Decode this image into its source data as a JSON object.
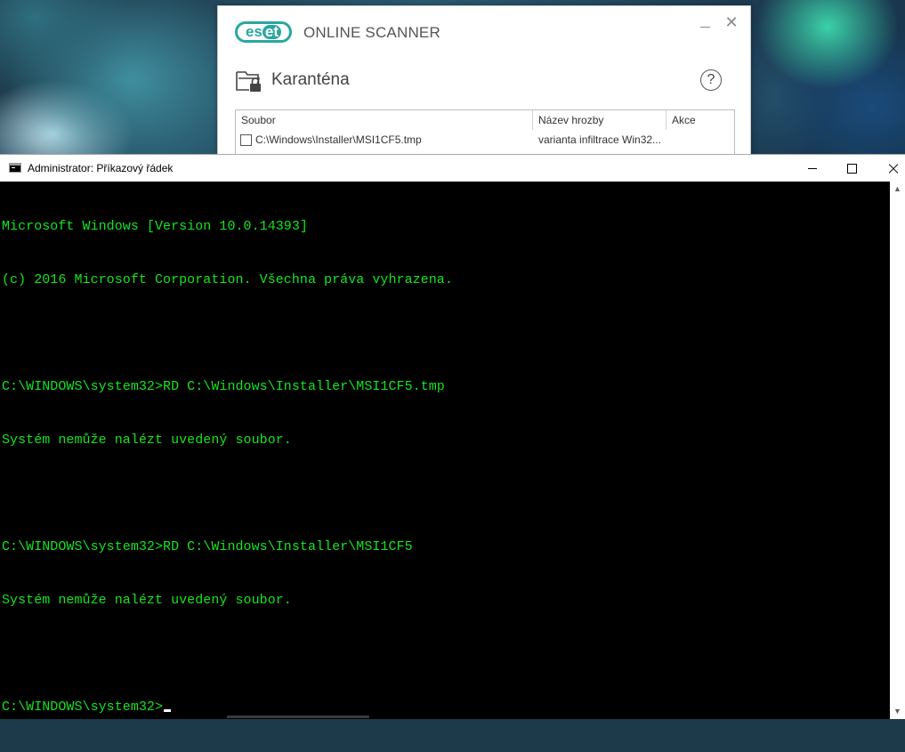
{
  "eset": {
    "logo_text_left": "es",
    "logo_text_right": "et",
    "app_name": "ONLINE SCANNER",
    "close_glyph": "✕",
    "section_title": "Karanténa",
    "help_glyph": "?",
    "table": {
      "columns": [
        "Soubor",
        "Název hrozby",
        "Akce"
      ],
      "rows": [
        {
          "file": "C:\\Windows\\Installer\\MSI1CF5.tmp",
          "threat": "varianta infiltrace Win32...",
          "checked": false
        }
      ]
    },
    "icons": {
      "quarantine": "quarantine-lock-icon",
      "help": "help-icon",
      "close": "close-icon",
      "minimize": "minimize-icon"
    },
    "accent_color": "#2aa6a0"
  },
  "cmd": {
    "title": "Administrator: Příkazový řádek",
    "lines": [
      "Microsoft Windows [Version 10.0.14393]",
      "(c) 2016 Microsoft Corporation. Všechna práva vyhrazena.",
      "",
      "C:\\WINDOWS\\system32>RD C:\\Windows\\Installer\\MSI1CF5.tmp",
      "Systém nemůže nalézt uvedený soubor.",
      "",
      "C:\\WINDOWS\\system32>RD C:\\Windows\\Installer\\MSI1CF5",
      "Systém nemůže nalézt uvedený soubor.",
      "",
      "C:\\WINDOWS\\system32>"
    ],
    "text_color": "#13e51e",
    "background_color": "#000000",
    "icons": {
      "app": "console-icon",
      "minimize": "minimize-icon",
      "maximize": "maximize-icon",
      "close": "close-icon"
    }
  }
}
